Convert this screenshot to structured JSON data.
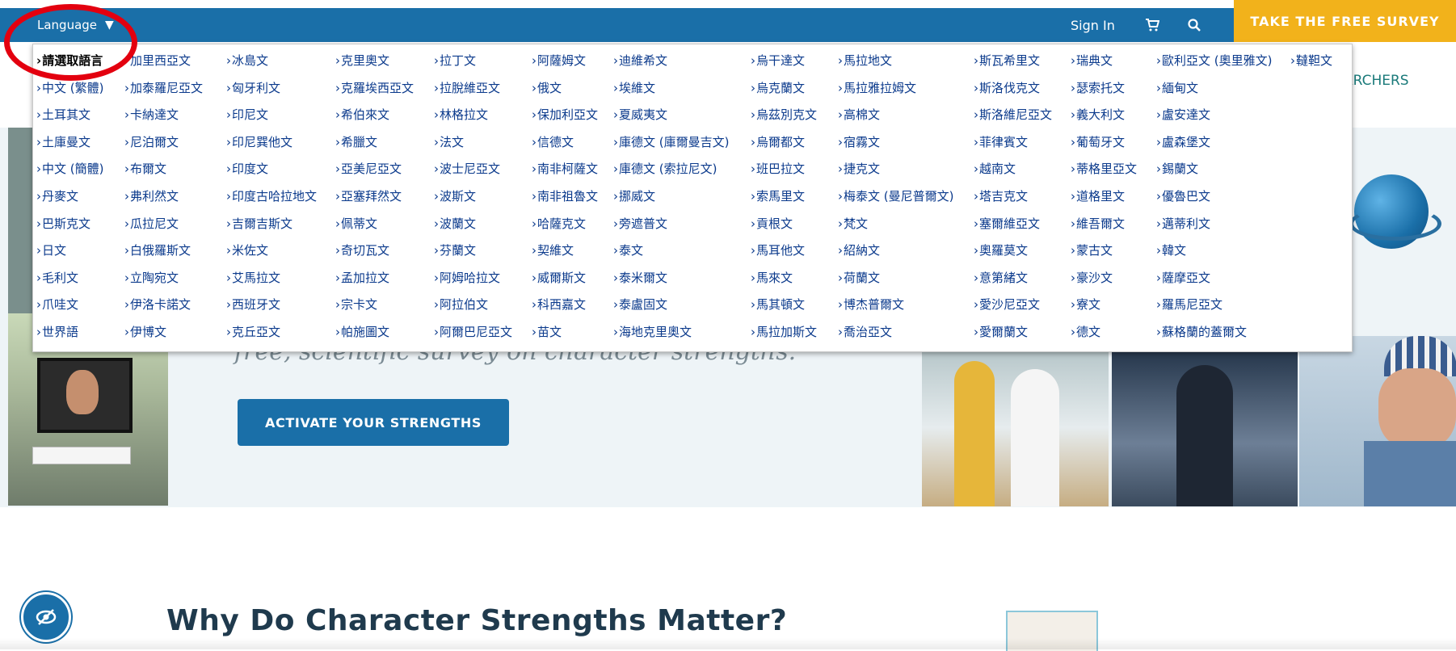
{
  "topbar": {
    "language_label": "Language",
    "language_caret": "▼",
    "sign_in": "Sign In",
    "cart_icon": "cart-icon",
    "search_icon": "search-icon",
    "survey_button": "TAKE THE FREE SURVEY"
  },
  "nav": {
    "researchers_fragment": "ARCHERS"
  },
  "hero": {
    "subtitle_fragment": "free, scientific survey on character strengths.",
    "activate_button": "ACTIVATE YOUR STRENGTHS"
  },
  "section": {
    "why_heading": "Why Do Character Strengths Matter?"
  },
  "language_menu": {
    "columns": [
      [
        "請選取語言",
        "中文 (繁體)",
        "土耳其文",
        "土庫曼文",
        "中文 (簡體)",
        "丹麥文",
        "巴斯克文",
        "日文",
        "毛利文",
        "爪哇文",
        "世界語"
      ],
      [
        "加里西亞文",
        "加泰羅尼亞文",
        "卡納達文",
        "尼泊爾文",
        "布爾文",
        "弗利然文",
        "瓜拉尼文",
        "白俄羅斯文",
        "立陶宛文",
        "伊洛卡諾文",
        "伊博文"
      ],
      [
        "冰島文",
        "匈牙利文",
        "印尼文",
        "印尼巽他文",
        "印度文",
        "印度古哈拉地文",
        "吉爾吉斯文",
        "米佐文",
        "艾馬拉文",
        "西班牙文",
        "克丘亞文"
      ],
      [
        "克里奧文",
        "克羅埃西亞文",
        "希伯來文",
        "希臘文",
        "亞美尼亞文",
        "亞塞拜然文",
        "佩蒂文",
        "奇切瓦文",
        "孟加拉文",
        "宗卡文",
        "帕施圖文"
      ],
      [
        "拉丁文",
        "拉脫維亞文",
        "林格拉文",
        "法文",
        "波士尼亞文",
        "波斯文",
        "波蘭文",
        "芬蘭文",
        "阿姆哈拉文",
        "阿拉伯文",
        "阿爾巴尼亞文"
      ],
      [
        "阿薩姆文",
        "俄文",
        "保加利亞文",
        "信德文",
        "南非柯薩文",
        "南非祖魯文",
        "哈薩克文",
        "契維文",
        "威爾斯文",
        "科西嘉文",
        "苗文"
      ],
      [
        "迪維希文",
        "埃維文",
        "夏威夷文",
        "庫德文 (庫爾曼吉文)",
        "庫德文 (索拉尼文)",
        "挪威文",
        "旁遮普文",
        "泰文",
        "泰米爾文",
        "泰盧固文",
        "海地克里奧文"
      ],
      [
        "烏干達文",
        "烏克蘭文",
        "烏茲別克文",
        "烏爾都文",
        "班巴拉文",
        "索馬里文",
        "貢根文",
        "馬耳他文",
        "馬來文",
        "馬其頓文",
        "馬拉加斯文"
      ],
      [
        "馬拉地文",
        "馬拉雅拉姆文",
        "高棉文",
        "宿霧文",
        "捷克文",
        "梅泰文 (曼尼普爾文)",
        "梵文",
        "紹納文",
        "荷蘭文",
        "博杰普爾文",
        "喬治亞文"
      ],
      [
        "斯瓦希里文",
        "斯洛伐克文",
        "斯洛維尼亞文",
        "菲律賓文",
        "越南文",
        "塔吉克文",
        "塞爾維亞文",
        "奧羅莫文",
        "意第緒文",
        "愛沙尼亞文",
        "愛爾蘭文"
      ],
      [
        "瑞典文",
        "瑟索托文",
        "義大利文",
        "葡萄牙文",
        "蒂格里亞文",
        "道格里文",
        "維吾爾文",
        "蒙古文",
        "豪沙文",
        "寮文",
        "德文"
      ],
      [
        "歐利亞文 (奧里雅文)",
        "緬甸文",
        "盧安達文",
        "盧森堡文",
        "錫蘭文",
        "優魯巴文",
        "邁蒂利文",
        "韓文",
        "薩摩亞文",
        "羅馬尼亞文",
        "蘇格蘭的蓋爾文"
      ],
      [
        "韃靼文"
      ]
    ]
  }
}
